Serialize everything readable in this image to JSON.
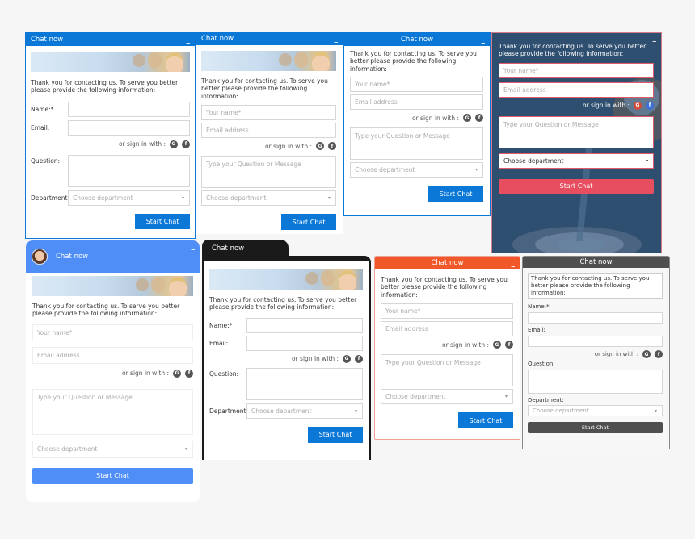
{
  "common": {
    "header_title": "Chat now",
    "minimize": "_",
    "intro": "Thank you for contacting us. To serve you better please provide the following information:",
    "labels": {
      "name": "Name:*",
      "email": "Email:",
      "question": "Question:",
      "department": "Department:"
    },
    "placeholders": {
      "name": "Your name*",
      "email": "Email address",
      "question": "Type your Question or Message",
      "department": "Choose department"
    },
    "signin_text": "or sign in with :",
    "google_icon": "G",
    "facebook_icon": "f",
    "caret": "▾",
    "button": "Start Chat"
  },
  "theme_colors": {
    "blue": "#0b78d8",
    "light_blue": "#4f8ef7",
    "dark_navy": "#2f4f70",
    "coral": "#e74e5f",
    "orange": "#f0582a",
    "black": "#1a1a1a",
    "gray": "#4f4f4f"
  },
  "widgets": [
    {
      "id": "blue-labeled",
      "title": "Chat now"
    },
    {
      "id": "blue-placeholder",
      "title": "Chat now"
    },
    {
      "id": "blue-centered",
      "title": "Chat now"
    },
    {
      "id": "navy-target",
      "title": ""
    },
    {
      "id": "light-blue-avatar",
      "title": "Chat now"
    },
    {
      "id": "black-tab",
      "title": "Chat now"
    },
    {
      "id": "orange",
      "title": "Chat now"
    },
    {
      "id": "gray",
      "title": "Chat now"
    }
  ]
}
